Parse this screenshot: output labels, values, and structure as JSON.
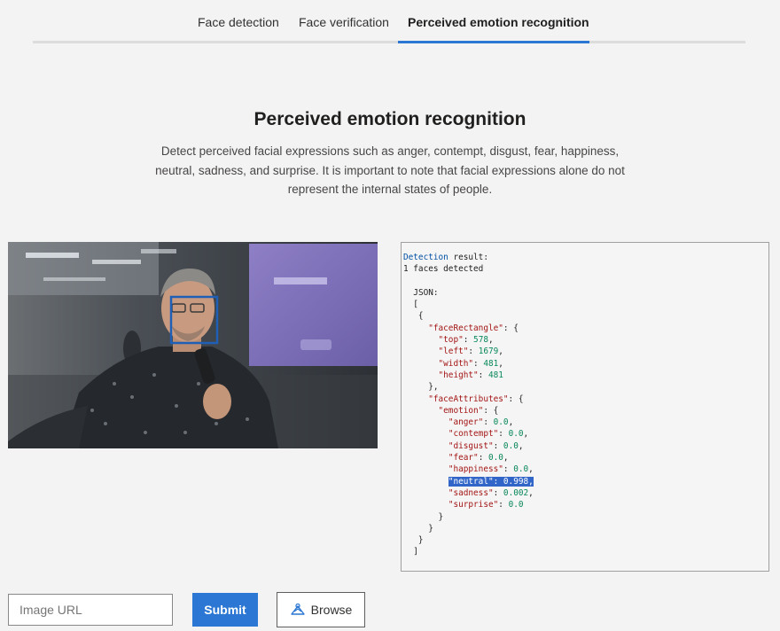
{
  "tabs": [
    {
      "label": "Face detection"
    },
    {
      "label": "Face verification"
    },
    {
      "label": "Perceived emotion recognition",
      "active": true
    }
  ],
  "accent_color": "#2b77d3",
  "page": {
    "title": "Perceived emotion recognition",
    "description_lines": [
      "Detect perceived facial expressions such as anger, contempt, disgust, fear, happiness,",
      "neutral, sadness, and surprise. It is important to note that facial expressions alone do not",
      "represent the internal states of people."
    ]
  },
  "image": {
    "alt_subject": "man holding microphone with detected face rectangle",
    "face_box_color": "#1f5fb5"
  },
  "result": {
    "detection_word": "Detection",
    "result_suffix": " result:",
    "faces_detected": "1 faces detected",
    "json_label": "JSON:",
    "faceRectangle": {
      "top": "578",
      "left": "1679",
      "width": "481",
      "height": "481"
    },
    "emotion": {
      "anger": "0.0",
      "contempt": "0.0",
      "disgust": "0.0",
      "fear": "0.0",
      "happiness": "0.0",
      "neutral": "0.998",
      "sadness": "0.002",
      "surprise": "0.0"
    },
    "highlighted_key": "neutral"
  },
  "controls": {
    "url_placeholder": "Image URL",
    "submit_label": "Submit",
    "browse_label": "Browse",
    "browse_icon": "image-upload-icon"
  }
}
